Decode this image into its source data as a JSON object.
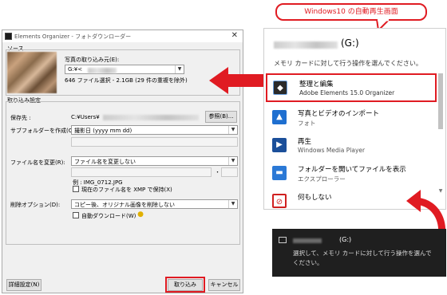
{
  "callout": {
    "text": "Windows10 の自動再生画面"
  },
  "dialog": {
    "title": "Elements Organizer - フォトダウンローダー",
    "source_label": "ソース",
    "copy_from_label": "写真の取り込み元(E):",
    "source_value": "G:¥<",
    "file_info": "646 ファイル選択 - 2.1GB (29 件の重複を除外)",
    "import_settings_label": "取り込み設定",
    "save_to_label": "保存先 :",
    "save_to_value": "C:¥Users¥",
    "browse_button": "参照(B)...",
    "subfolder_label": "サブフォルダーを作成(C):",
    "subfolder_value": "撮影日 (yyyy mm dd)",
    "rename_label": "ファイル名を変更(R):",
    "rename_value": "ファイル名を変更しない",
    "rename_dot": "・",
    "example_text": "例 : IMG_0712.JPG",
    "xmp_checkbox": "現在のファイル名を XMP で保持(X)",
    "delete_label": "削除オプション(D):",
    "delete_value": "コピー後、オリジナル画像を削除しない",
    "auto_download": "自動ダウンロード(W)",
    "advanced_button": "詳細設定(N)",
    "import_button": "取り込み",
    "cancel_button": "キャンセル"
  },
  "autoplay": {
    "drive_label": "(G:)",
    "prompt": "メモリ カードに対して行う操作を選んでください。",
    "items": [
      {
        "title": "整理と編集",
        "subtitle": "Adobe Elements 15.0 Organizer",
        "icon": "elements-organizer-icon"
      },
      {
        "title": "写真とビデオのインポート",
        "subtitle": "フォト",
        "icon": "photos-icon"
      },
      {
        "title": "再生",
        "subtitle": "Windows Media Player",
        "icon": "media-player-icon"
      },
      {
        "title": "フォルダーを開いてファイルを表示",
        "subtitle": "エクスプローラー",
        "icon": "folder-icon"
      },
      {
        "title": "何もしない",
        "subtitle": "",
        "icon": "block-icon"
      }
    ]
  },
  "toast": {
    "drive_label": "(G:)",
    "message_line1": "選択して、メモリ カードに対して行う操作を選んで",
    "message_line2": "ください。"
  },
  "colors": {
    "accent_red": "#e01b22",
    "toast_bg": "#1f1f1f",
    "win_blue": "#1e6fd0"
  }
}
